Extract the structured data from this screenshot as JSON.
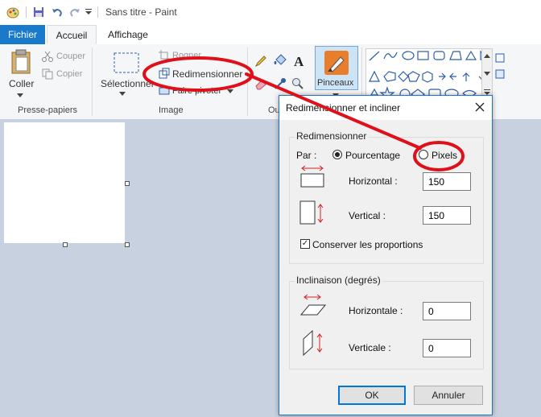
{
  "window": {
    "title": "Sans titre - Paint"
  },
  "tabs": [
    {
      "label": "Fichier"
    },
    {
      "label": "Accueil"
    },
    {
      "label": "Affichage"
    }
  ],
  "ribbon": {
    "clipboard": {
      "paste": "Coller",
      "cut": "Couper",
      "copy": "Copier",
      "group": "Presse-papiers"
    },
    "image": {
      "select": "Sélectionner",
      "crop": "Rogner",
      "resize": "Redimensionner",
      "rotate": "Faire pivoter",
      "group": "Image"
    },
    "tools": {
      "group": "Ou"
    },
    "brushes": {
      "label": "Pinceaux"
    }
  },
  "dialog": {
    "title": "Redimensionner et incliner",
    "close_icon": "close-icon",
    "resize": {
      "legend": "Redimensionner",
      "by_label": "Par :",
      "option_percent": "Pourcentage",
      "option_pixels": "Pixels",
      "selected": "Pourcentage",
      "horizontal_label": "Horizontal :",
      "horizontal_value": "150",
      "vertical_label": "Vertical :",
      "vertical_value": "150",
      "keep_ratio_label": "Conserver les proportions",
      "keep_ratio_checked": true
    },
    "skew": {
      "legend": "Inclinaison (degrés)",
      "horizontal_label": "Horizontale :",
      "horizontal_value": "0",
      "vertical_label": "Verticale :",
      "vertical_value": "0"
    },
    "ok_label": "OK",
    "cancel_label": "Annuler"
  },
  "colors": {
    "accent": "#1979ca",
    "annotation": "#e0101a",
    "workspace": "#c8d1e0"
  }
}
